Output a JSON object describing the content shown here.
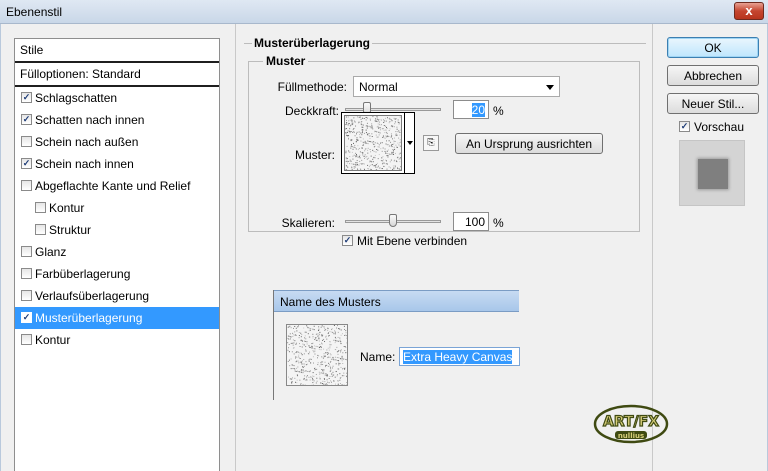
{
  "window": {
    "title": "Ebenenstil",
    "close_glyph": "x"
  },
  "stile_list": {
    "header": "Stile",
    "fill_options": "Fülloptionen: Standard",
    "items": [
      {
        "label": "Schlagschatten",
        "checked": true,
        "sub": false,
        "selected": false
      },
      {
        "label": "Schatten nach innen",
        "checked": true,
        "sub": false,
        "selected": false
      },
      {
        "label": "Schein nach außen",
        "checked": false,
        "sub": false,
        "selected": false
      },
      {
        "label": "Schein nach innen",
        "checked": true,
        "sub": false,
        "selected": false
      },
      {
        "label": "Abgeflachte Kante und Relief",
        "checked": false,
        "sub": false,
        "selected": false
      },
      {
        "label": "Kontur",
        "checked": false,
        "sub": true,
        "selected": false
      },
      {
        "label": "Struktur",
        "checked": false,
        "sub": true,
        "selected": false
      },
      {
        "label": "Glanz",
        "checked": false,
        "sub": false,
        "selected": false
      },
      {
        "label": "Farbüberlagerung",
        "checked": false,
        "sub": false,
        "selected": false
      },
      {
        "label": "Verlaufsüberlagerung",
        "checked": false,
        "sub": false,
        "selected": false
      },
      {
        "label": "Musterüberlagerung",
        "checked": true,
        "sub": false,
        "selected": true
      },
      {
        "label": "Kontur",
        "checked": false,
        "sub": false,
        "selected": false
      }
    ]
  },
  "panel": {
    "title": "Musterüberlagerung",
    "group": "Muster",
    "blend_mode_label": "Füllmethode:",
    "blend_mode_value": "Normal",
    "opacity_label": "Deckkraft:",
    "opacity_value": "20",
    "opacity_percent": 20,
    "opacity_unit": "%",
    "pattern_label": "Muster:",
    "snap_button": "An Ursprung ausrichten",
    "scale_label": "Skalieren:",
    "scale_value": "100",
    "scale_percent": 100,
    "scale_unit": "%",
    "link_label": "Mit Ebene verbinden",
    "link_checked": true
  },
  "name_popup": {
    "title": "Name des Musters",
    "name_label": "Name:",
    "name_value": "Extra Heavy Canvas"
  },
  "buttons": {
    "ok": "OK",
    "cancel": "Abbrechen",
    "new_style": "Neuer Stil...",
    "preview_label": "Vorschau",
    "preview_checked": true
  },
  "logo": {
    "line1": "ART/FX",
    "line2": "nullius"
  },
  "colors": {
    "selection": "#3399ff",
    "logo_green": "#3f4a12",
    "logo_fill": "#d8cf7a"
  }
}
